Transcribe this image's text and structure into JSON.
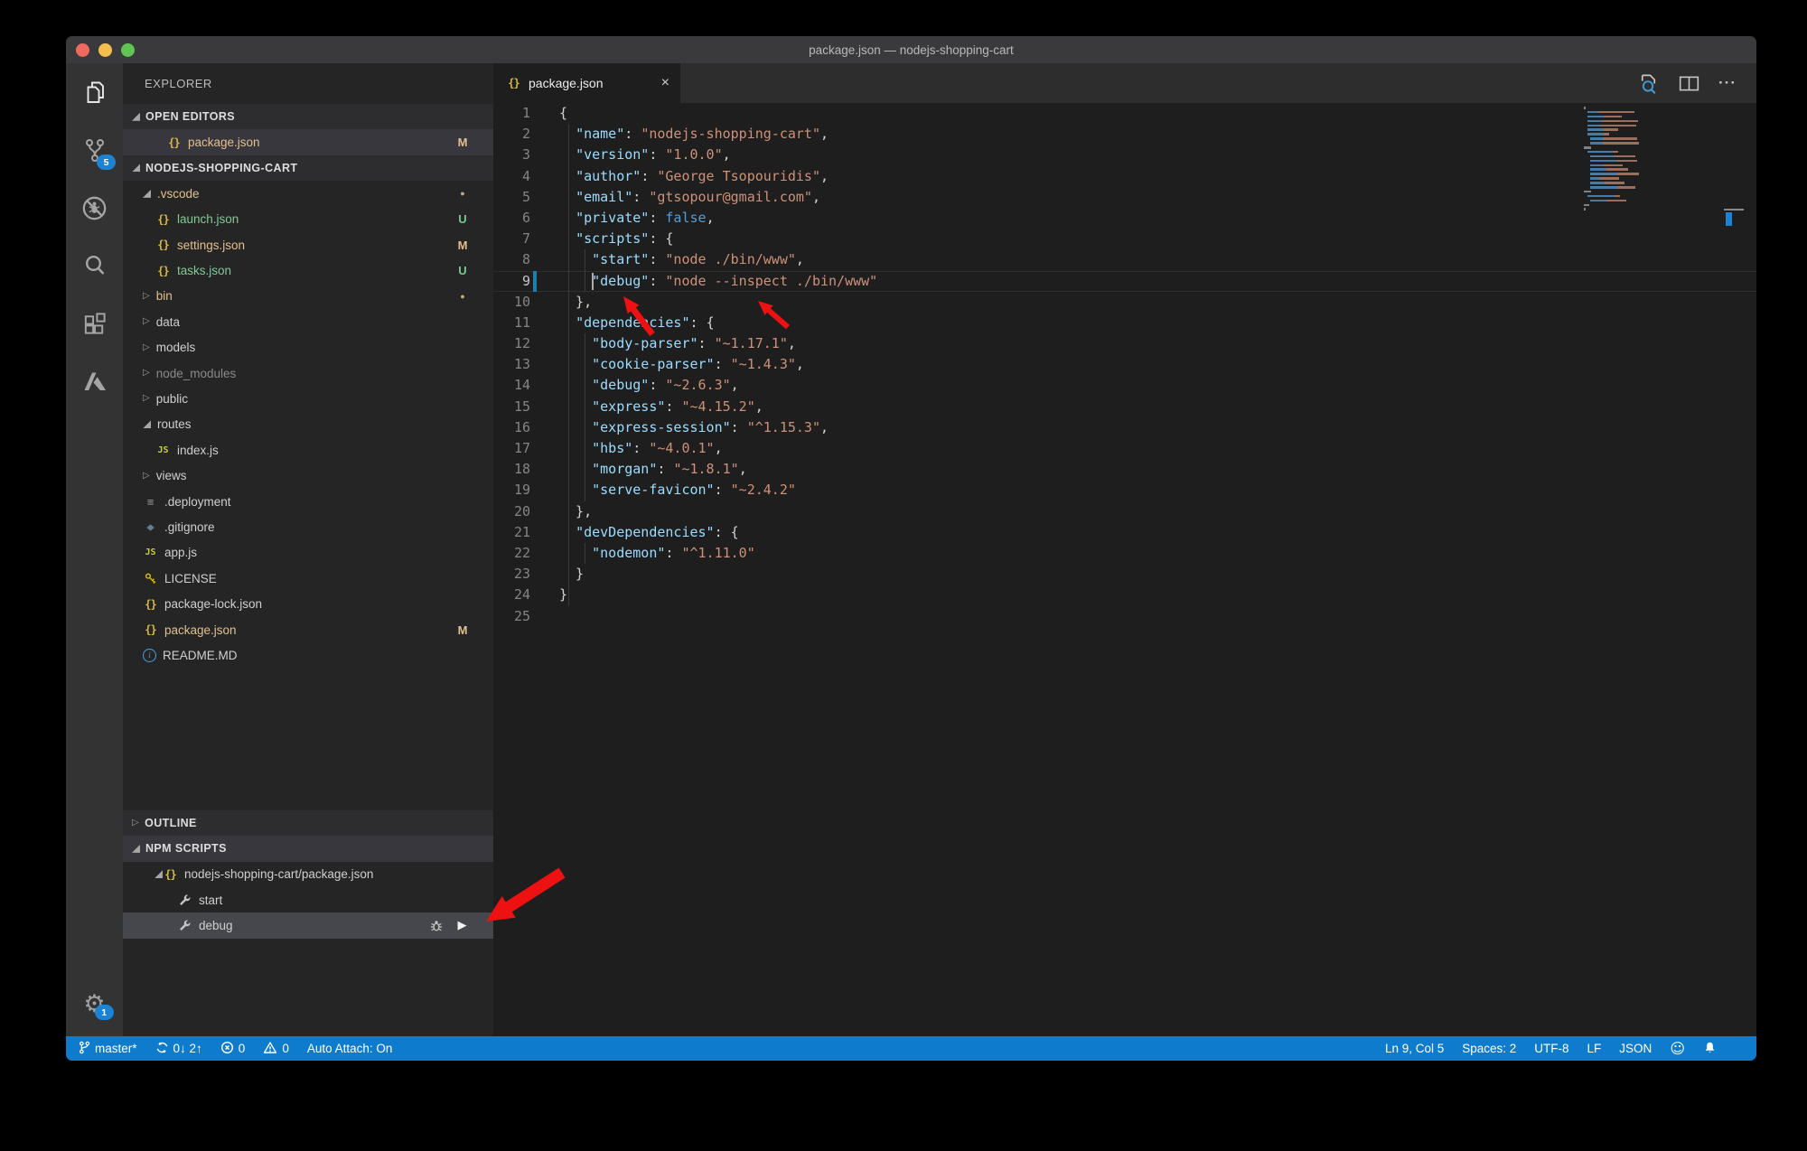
{
  "window": {
    "title": "package.json — nodejs-shopping-cart"
  },
  "glyphs": {
    "json_braces": "{}",
    "js": "JS",
    "list": "≡",
    "diamond": "◆",
    "play": "▶",
    "gear": "⚙",
    "smiley": "☺",
    "more": "···",
    "close": "×",
    "twisty_collapsed": "▷",
    "info": "i"
  },
  "activity_bar": {
    "scm_badge": "5",
    "settings_badge": "1",
    "items": [
      "explorer",
      "source-control",
      "debug",
      "search",
      "extensions",
      "azure"
    ]
  },
  "sidebar": {
    "title": "EXPLORER",
    "sections": {
      "open_editors": "OPEN EDITORS",
      "project": "NODEJS-SHOPPING-CART",
      "outline": "OUTLINE",
      "npm_scripts": "NPM SCRIPTS"
    },
    "open_editor_items": [
      {
        "label": "package.json",
        "icon": "json",
        "color": "modified",
        "badge": "M",
        "selected": true
      }
    ],
    "tree": [
      {
        "label": ".vscode",
        "level": 0,
        "twisty": "exp",
        "color": "modified",
        "badge": "dot"
      },
      {
        "label": "launch.json",
        "level": 1,
        "icon": "json",
        "color": "untracked",
        "badge": "U"
      },
      {
        "label": "settings.json",
        "level": 1,
        "icon": "json",
        "color": "modified",
        "badge": "M"
      },
      {
        "label": "tasks.json",
        "level": 1,
        "icon": "json",
        "color": "untracked",
        "badge": "U"
      },
      {
        "label": "bin",
        "level": 0,
        "twisty": "col",
        "color": "modified",
        "badge": "dot"
      },
      {
        "label": "data",
        "level": 0,
        "twisty": "col"
      },
      {
        "label": "models",
        "level": 0,
        "twisty": "col"
      },
      {
        "label": "node_modules",
        "level": 0,
        "twisty": "col",
        "color": "ignored"
      },
      {
        "label": "public",
        "level": 0,
        "twisty": "col"
      },
      {
        "label": "routes",
        "level": 0,
        "twisty": "exp"
      },
      {
        "label": "index.js",
        "level": 1,
        "icon": "js"
      },
      {
        "label": "views",
        "level": 0,
        "twisty": "col"
      },
      {
        "label": ".deployment",
        "level": 0,
        "icon": "list"
      },
      {
        "label": ".gitignore",
        "level": 0,
        "icon": "diamond"
      },
      {
        "label": "app.js",
        "level": 0,
        "icon": "js"
      },
      {
        "label": "LICENSE",
        "level": 0,
        "icon": "key"
      },
      {
        "label": "package-lock.json",
        "level": 0,
        "icon": "json"
      },
      {
        "label": "package.json",
        "level": 0,
        "icon": "json",
        "color": "modified",
        "badge": "M"
      },
      {
        "label": "README.MD",
        "level": 0,
        "icon": "info"
      }
    ],
    "npm": {
      "package": {
        "label": "nodejs-shopping-cart/package.json",
        "icon": "json"
      },
      "scripts": [
        {
          "label": "start",
          "icon": "wrench"
        },
        {
          "label": "debug",
          "icon": "wrench",
          "selected": true,
          "actions": [
            "bug",
            "play"
          ]
        }
      ]
    }
  },
  "editor": {
    "tab": {
      "label": "package.json",
      "icon": "json"
    },
    "active_line": 9,
    "cursor_col": 5,
    "lines": [
      {
        "n": 1,
        "seg": [
          [
            "{",
            "p"
          ]
        ]
      },
      {
        "n": 2,
        "seg": [
          [
            "  ",
            "t"
          ],
          [
            "\"name\"",
            "k"
          ],
          [
            ": ",
            "p"
          ],
          [
            "\"nodejs-shopping-cart\"",
            "s"
          ],
          [
            ",",
            "p"
          ]
        ]
      },
      {
        "n": 3,
        "seg": [
          [
            "  ",
            "t"
          ],
          [
            "\"version\"",
            "k"
          ],
          [
            ": ",
            "p"
          ],
          [
            "\"1.0.0\"",
            "s"
          ],
          [
            ",",
            "p"
          ]
        ]
      },
      {
        "n": 4,
        "seg": [
          [
            "  ",
            "t"
          ],
          [
            "\"author\"",
            "k"
          ],
          [
            ": ",
            "p"
          ],
          [
            "\"George Tsopouridis\"",
            "s"
          ],
          [
            ",",
            "p"
          ]
        ]
      },
      {
        "n": 5,
        "seg": [
          [
            "  ",
            "t"
          ],
          [
            "\"email\"",
            "k"
          ],
          [
            ": ",
            "p"
          ],
          [
            "\"gtsopour@gmail.com\"",
            "s"
          ],
          [
            ",",
            "p"
          ]
        ]
      },
      {
        "n": 6,
        "seg": [
          [
            "  ",
            "t"
          ],
          [
            "\"private\"",
            "k"
          ],
          [
            ": ",
            "p"
          ],
          [
            "false",
            "b"
          ],
          [
            ",",
            "p"
          ]
        ]
      },
      {
        "n": 7,
        "seg": [
          [
            "  ",
            "t"
          ],
          [
            "\"scripts\"",
            "k"
          ],
          [
            ": ",
            "p"
          ],
          [
            "{",
            "p"
          ]
        ]
      },
      {
        "n": 8,
        "seg": [
          [
            "    ",
            "t"
          ],
          [
            "\"start\"",
            "k"
          ],
          [
            ": ",
            "p"
          ],
          [
            "\"node ./bin/www\"",
            "s"
          ],
          [
            ",",
            "p"
          ]
        ]
      },
      {
        "n": 9,
        "seg": [
          [
            "    ",
            "t"
          ],
          [
            "\"debug\"",
            "k"
          ],
          [
            ": ",
            "p"
          ],
          [
            "\"node --inspect ./bin/www\"",
            "s"
          ]
        ]
      },
      {
        "n": 10,
        "seg": [
          [
            "  },",
            "p"
          ]
        ]
      },
      {
        "n": 11,
        "seg": [
          [
            "  ",
            "t"
          ],
          [
            "\"dependencies\"",
            "k"
          ],
          [
            ": ",
            "p"
          ],
          [
            "{",
            "p"
          ]
        ]
      },
      {
        "n": 12,
        "seg": [
          [
            "    ",
            "t"
          ],
          [
            "\"body-parser\"",
            "k"
          ],
          [
            ": ",
            "p"
          ],
          [
            "\"~1.17.1\"",
            "s"
          ],
          [
            ",",
            "p"
          ]
        ]
      },
      {
        "n": 13,
        "seg": [
          [
            "    ",
            "t"
          ],
          [
            "\"cookie-parser\"",
            "k"
          ],
          [
            ": ",
            "p"
          ],
          [
            "\"~1.4.3\"",
            "s"
          ],
          [
            ",",
            "p"
          ]
        ]
      },
      {
        "n": 14,
        "seg": [
          [
            "    ",
            "t"
          ],
          [
            "\"debug\"",
            "k"
          ],
          [
            ": ",
            "p"
          ],
          [
            "\"~2.6.3\"",
            "s"
          ],
          [
            ",",
            "p"
          ]
        ]
      },
      {
        "n": 15,
        "seg": [
          [
            "    ",
            "t"
          ],
          [
            "\"express\"",
            "k"
          ],
          [
            ": ",
            "p"
          ],
          [
            "\"~4.15.2\"",
            "s"
          ],
          [
            ",",
            "p"
          ]
        ]
      },
      {
        "n": 16,
        "seg": [
          [
            "    ",
            "t"
          ],
          [
            "\"express-session\"",
            "k"
          ],
          [
            ": ",
            "p"
          ],
          [
            "\"^1.15.3\"",
            "s"
          ],
          [
            ",",
            "p"
          ]
        ]
      },
      {
        "n": 17,
        "seg": [
          [
            "    ",
            "t"
          ],
          [
            "\"hbs\"",
            "k"
          ],
          [
            ": ",
            "p"
          ],
          [
            "\"~4.0.1\"",
            "s"
          ],
          [
            ",",
            "p"
          ]
        ]
      },
      {
        "n": 18,
        "seg": [
          [
            "    ",
            "t"
          ],
          [
            "\"morgan\"",
            "k"
          ],
          [
            ": ",
            "p"
          ],
          [
            "\"~1.8.1\"",
            "s"
          ],
          [
            ",",
            "p"
          ]
        ]
      },
      {
        "n": 19,
        "seg": [
          [
            "    ",
            "t"
          ],
          [
            "\"serve-favicon\"",
            "k"
          ],
          [
            ": ",
            "p"
          ],
          [
            "\"~2.4.2\"",
            "s"
          ]
        ]
      },
      {
        "n": 20,
        "seg": [
          [
            "  },",
            "p"
          ]
        ]
      },
      {
        "n": 21,
        "seg": [
          [
            "  ",
            "t"
          ],
          [
            "\"devDependencies\"",
            "k"
          ],
          [
            ": ",
            "p"
          ],
          [
            "{",
            "p"
          ]
        ]
      },
      {
        "n": 22,
        "seg": [
          [
            "    ",
            "t"
          ],
          [
            "\"nodemon\"",
            "k"
          ],
          [
            ": ",
            "p"
          ],
          [
            "\"^1.11.0\"",
            "s"
          ]
        ]
      },
      {
        "n": 23,
        "seg": [
          [
            "  }",
            "p"
          ]
        ]
      },
      {
        "n": 24,
        "seg": [
          [
            "}",
            "p"
          ]
        ]
      },
      {
        "n": 25,
        "seg": []
      }
    ]
  },
  "status_bar": {
    "left": [
      {
        "name": "branch-status",
        "icon": "branch",
        "label": "master*"
      },
      {
        "name": "sync-status",
        "icon": "sync",
        "label": "0↓ 2↑"
      },
      {
        "name": "errors-status",
        "icon": "error",
        "label": "0"
      },
      {
        "name": "warnings-status",
        "icon": "warning",
        "label": "0"
      },
      {
        "name": "auto-attach-status",
        "label": "Auto Attach: On"
      }
    ],
    "right": [
      {
        "name": "cursor-position-status",
        "label": "Ln 9, Col 5"
      },
      {
        "name": "indentation-status",
        "label": "Spaces: 2"
      },
      {
        "name": "encoding-status",
        "label": "UTF-8"
      },
      {
        "name": "eol-status",
        "label": "LF"
      },
      {
        "name": "language-status",
        "label": "JSON"
      },
      {
        "name": "feedback-smiley",
        "icon": "smiley"
      },
      {
        "name": "notifications-bell",
        "icon": "bell"
      }
    ]
  },
  "colors": {
    "status_bar": "#0e7bcd",
    "annotation_arrow": "#ee1111",
    "activity_badge": "#1b82d4"
  }
}
